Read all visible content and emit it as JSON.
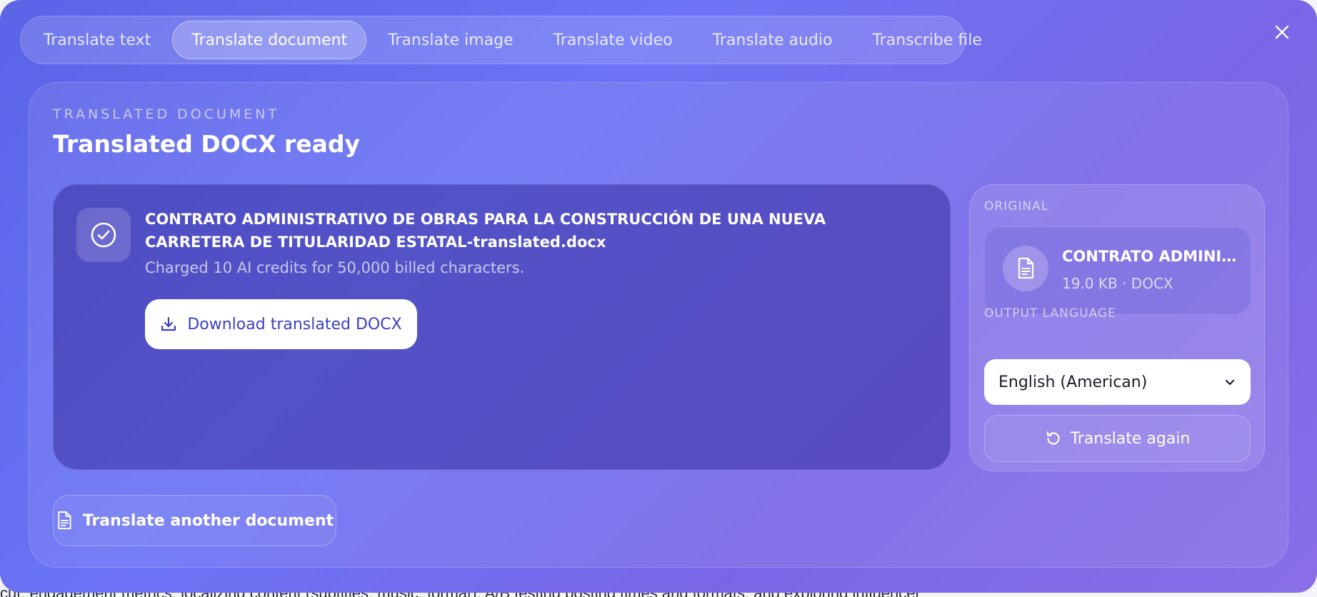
{
  "tabs": [
    {
      "label": "Translate text"
    },
    {
      "label": "Translate document"
    },
    {
      "label": "Translate image"
    },
    {
      "label": "Translate video"
    },
    {
      "label": "Translate audio"
    },
    {
      "label": "Transcribe file"
    }
  ],
  "active_tab": "Translate document",
  "result": {
    "eyebrow": "TRANSLATED DOCUMENT",
    "title": "Translated DOCX ready",
    "file_name": "CONTRATO ADMINISTRATIVO DE OBRAS PARA LA CONSTRUCCIÓN DE UNA NUEVA CARRETERA DE TITULARIDAD ESTATAL-translated.docx",
    "charged": "Charged 10 AI credits for 50,000 billed characters.",
    "download_label": "Download translated DOCX"
  },
  "original": {
    "label": "ORIGINAL",
    "file_name": "CONTRATO ADMINIS...",
    "meta": "19.0 KB · DOCX"
  },
  "output_language": {
    "label": "OUTPUT LANGUAGE",
    "value": "English (American)"
  },
  "translate_again_label": "Translate again",
  "translate_another_label": "Translate another document",
  "background_text": "cut, engagement metrics, localizing content (subtitles, music, format), A/B testing posting times and formats, and exploring influencer",
  "icons": {
    "check": "check-circle-icon",
    "download": "download-icon",
    "file": "document-icon",
    "chevron": "chevron-down-icon",
    "refresh": "refresh-icon",
    "close": "close-icon"
  },
  "colors": {
    "accent": "#3a3fc2",
    "modal_gradient_start": "#5b63e6",
    "modal_gradient_end": "#8a6ee8"
  }
}
